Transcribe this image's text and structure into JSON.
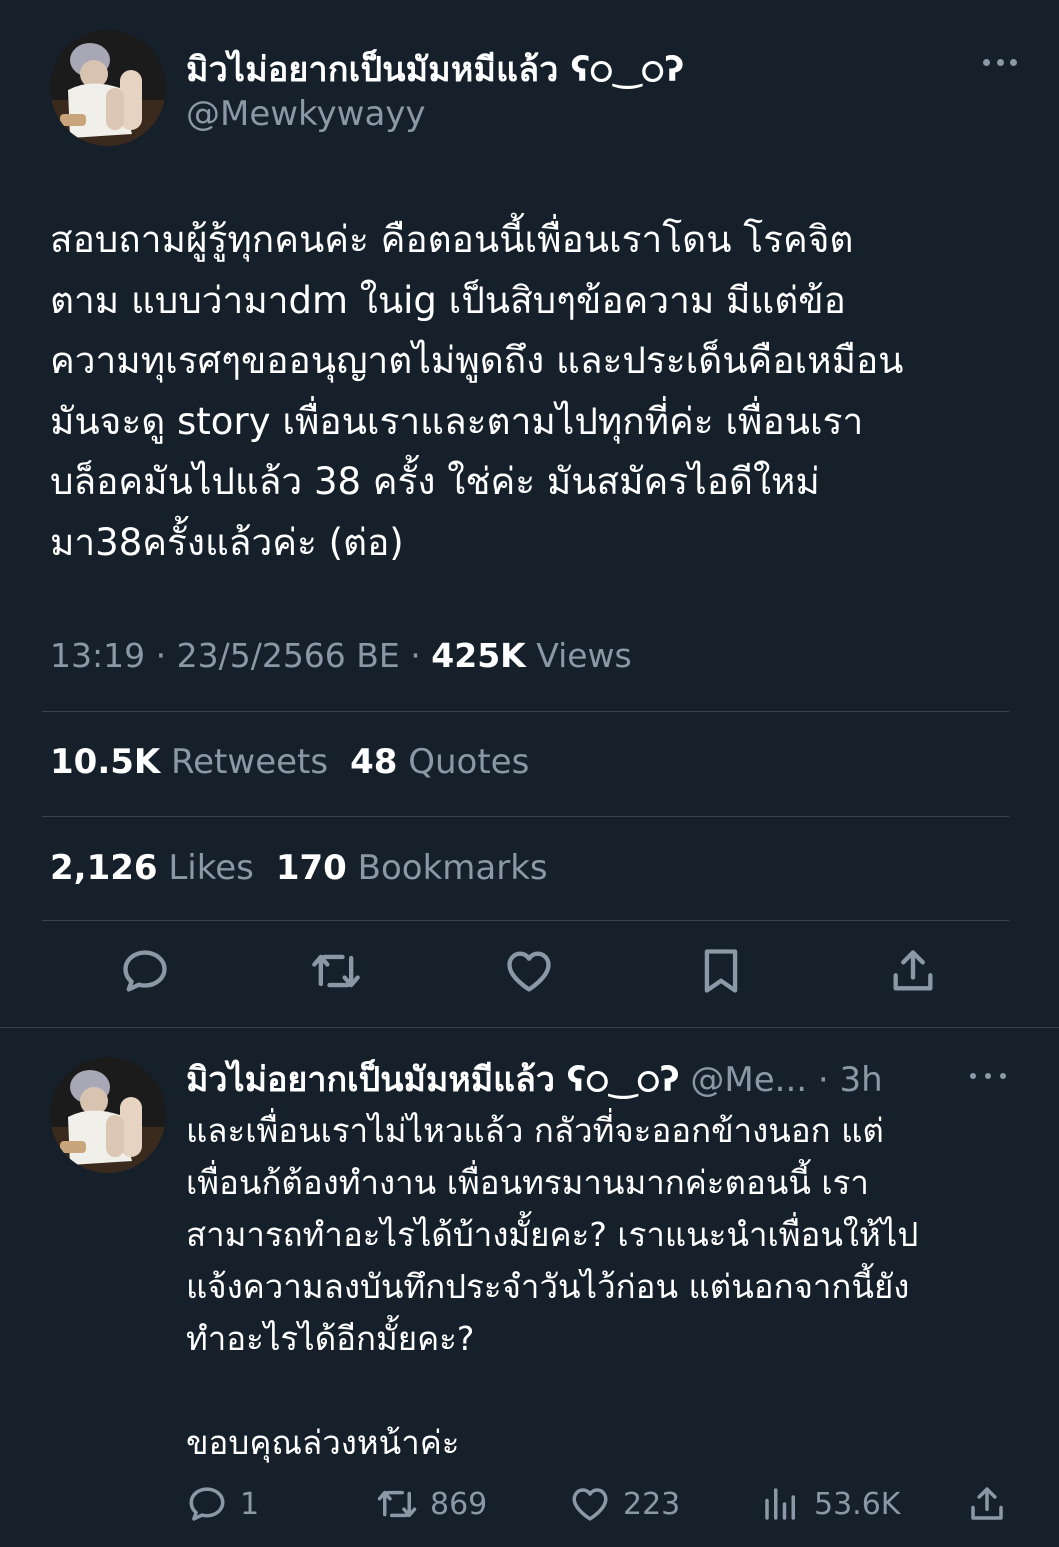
{
  "tweet": {
    "author_name": "มิวไม่อยากเป็นมัมหมีแล้ว ʕ੦‿੦ʔ",
    "author_handle": "@Mewkywayy",
    "text_lines": [
      "สอบถามผู้รู้ทุกคนค่ะ คือตอนนี้เพื่อนเราโดน โรคจิต",
      "ตาม แบบว่ามาdm ในig เป็นสิบๆข้อความ มีแต่ข้อ",
      "ความทุเรศๆขออนุญาตไม่พูดถึง และประเด็นคือเหมือน",
      "มันจะดู story เพื่อนเราและตามไปทุกที่ค่ะ เพื่อนเรา",
      "บล็อคมันไปแล้ว 38 ครั้ง ใช่ค่ะ มันสมัครไอดีใหม่",
      "มา38ครั้งแล้วค่ะ (ต่อ)"
    ],
    "time": "13:19",
    "date": "23/5/2566 BE",
    "views_count": "425K",
    "views_label": "Views",
    "retweets_count": "10.5K",
    "retweets_label": "Retweets",
    "quotes_count": "48",
    "quotes_label": "Quotes",
    "likes_count": "2,126",
    "likes_label": "Likes",
    "bookmarks_count": "170",
    "bookmarks_label": "Bookmarks",
    "action_icons": [
      "reply-icon",
      "retweet-icon",
      "like-icon",
      "bookmark-icon",
      "share-icon"
    ]
  },
  "reply": {
    "author_name": "มิวไม่อยากเป็นมัมหมีแล้ว ʕ੦‿੦ʔ",
    "handle_truncated": "@Me...",
    "age": "3h",
    "text_lines": [
      "และเพื่อนเราไม่ไหวแล้ว กลัวที่จะออกข้างนอก แต่",
      "เพื่อนก้ต้องทำงาน เพื่อนทรมานมากค่ะตอนนี้ เรา",
      "สามารถทำอะไรได้บ้างมั้ยคะ? เราแนะนำเพื่อนให้ไป",
      "แจ้งความลงบันทึกประจำวันไว้ก่อน แต่นอกจากนี้ยัง",
      "ทำอะไรได้อีกมั้ยคะ?",
      "",
      "ขอบคุณล่วงหน้าค่ะ"
    ],
    "replies": "1",
    "retweets": "869",
    "likes": "223",
    "views": "53.6K"
  },
  "colors": {
    "background": "#15202b",
    "primary_text": "#ffffff",
    "secondary_text": "#8b98a5",
    "divider": "#38444d"
  }
}
